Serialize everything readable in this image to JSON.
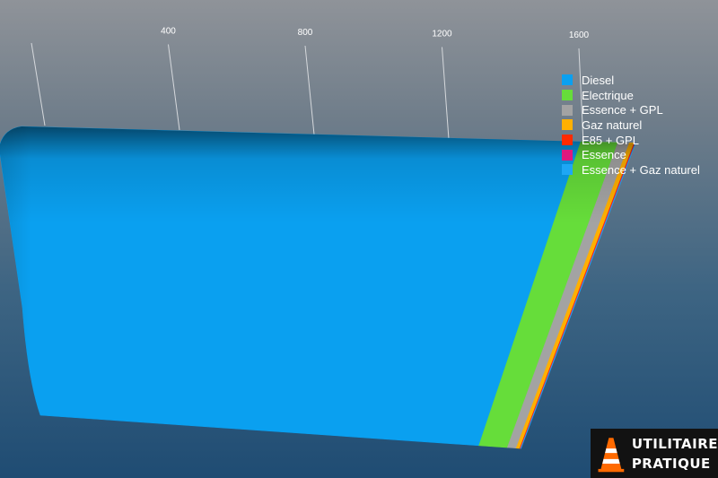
{
  "chart_data": {
    "type": "bar",
    "orientation": "horizontal",
    "stacked": true,
    "x_ticks": [
      "400",
      "800",
      "1200",
      "1600"
    ],
    "xlim": [
      0,
      1600
    ],
    "grid": true,
    "legend_position": "top-right",
    "series": [
      {
        "name": "Diesel",
        "value": 1505,
        "color": "#0aa0f0"
      },
      {
        "name": "Electrique",
        "value": 96,
        "color": "#66dd3a"
      },
      {
        "name": "Essence + GPL",
        "value": 30,
        "color": "#a3a3a3"
      },
      {
        "name": "Gaz naturel",
        "value": 12,
        "color": "#ffb000"
      },
      {
        "name": "E85 + GPL",
        "value": 2,
        "color": "#ff2a00"
      },
      {
        "name": "Essence",
        "value": 1,
        "color": "#e0187e"
      },
      {
        "name": "Essence + Gaz naturel",
        "value": 1,
        "color": "#1ea7f5"
      }
    ]
  },
  "logo": {
    "line1": "UTILITAIRE",
    "line2": "PRATIQUE"
  }
}
